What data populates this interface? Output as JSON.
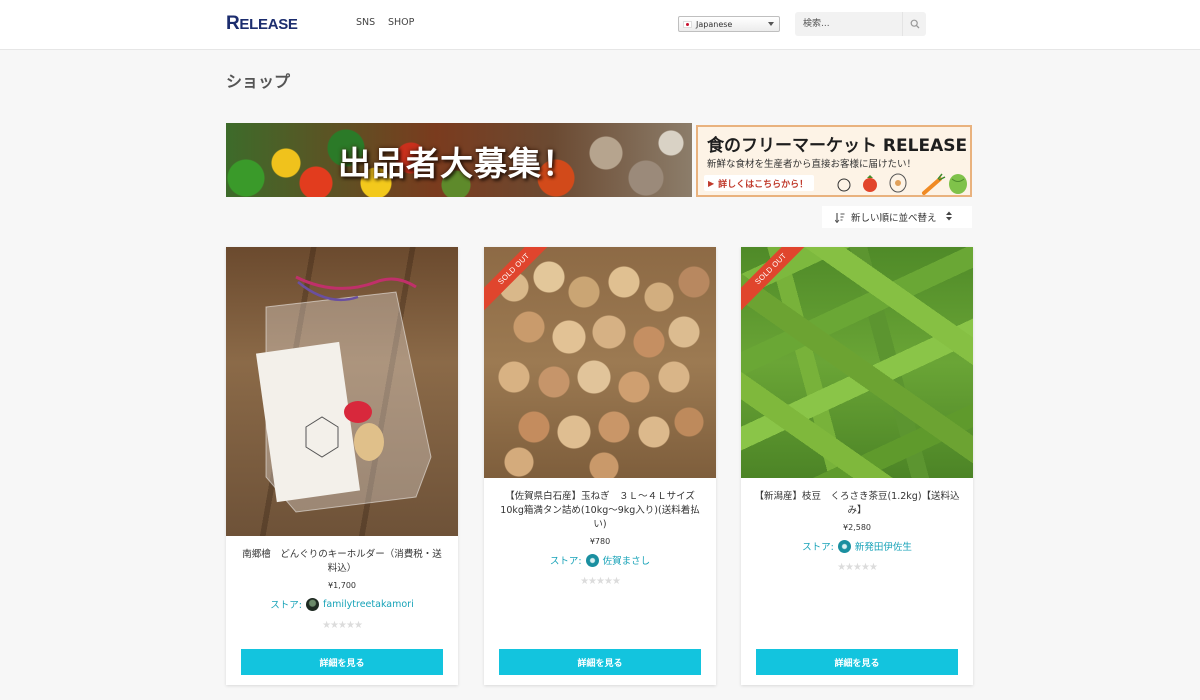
{
  "header": {
    "logo_first": "R",
    "logo_rest": "ELEASE",
    "nav": [
      "SNS",
      "SHOP"
    ],
    "language": "Japanese",
    "search_placeholder": "検索..."
  },
  "page": {
    "title": "ショップ"
  },
  "banner": {
    "headline": "出品者大募集！",
    "info_title": "食のフリーマーケット RELEASE",
    "info_subtitle": "新鮮な食材を生産者から直接お客様に届けたい！",
    "info_cta": "詳しくはこちらから！"
  },
  "sort": {
    "label": "新しい順に並べ替え"
  },
  "products": [
    {
      "name": "南郷檜　どんぐりのキーホルダー（消費税・送料込）",
      "price": "¥1,700",
      "store_label": "ストア:",
      "store_name": "familytreetakamori",
      "sold_out": false,
      "button": "詳細を見る"
    },
    {
      "name": "【佐賀県白石産】玉ねぎ　３Ｌ〜４Ｌサイズ 10kg箱満タン詰め(10kg〜9kg入り)(送料着払い)",
      "price": "¥780",
      "store_label": "ストア:",
      "store_name": "佐賀まさし",
      "sold_out": true,
      "badge": "SOLD OUT",
      "button": "詳細を見る"
    },
    {
      "name": "【新潟産】枝豆　くろさき茶豆(1.2kg)【送料込み】",
      "price": "¥2,580",
      "store_label": "ストア:",
      "store_name": "新発田伊佐生",
      "sold_out": true,
      "badge": "SOLD OUT",
      "button": "詳細を見る"
    }
  ],
  "colors": {
    "accent": "#13c4de",
    "link": "#18a3b8",
    "sold_out": "#e0452d",
    "logo": "#1c2d6e"
  },
  "icons": [
    "flag-japan-icon",
    "search-icon",
    "sort-icon",
    "updown-icon",
    "star-icon"
  ]
}
